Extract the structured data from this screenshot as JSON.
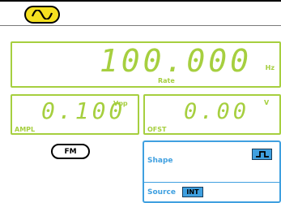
{
  "colors": {
    "accent_green": "#a6cf3f",
    "accent_blue": "#3fa0e0",
    "selector_yellow": "#f5e020"
  },
  "waveform_icon": "sine-wave-icon",
  "rate": {
    "value": "100.000",
    "unit": "Hz",
    "label": "Rate"
  },
  "ampl": {
    "value": "0.100",
    "unit": "Vpp",
    "label": "AMPL"
  },
  "ofst": {
    "value": "0.00",
    "unit": "V",
    "label": "OFST"
  },
  "mode_button": {
    "label": "FM"
  },
  "settings": {
    "shape_label": "Shape",
    "shape_icon": "square-wave-icon",
    "source_label": "Source",
    "source_value": "INT"
  }
}
